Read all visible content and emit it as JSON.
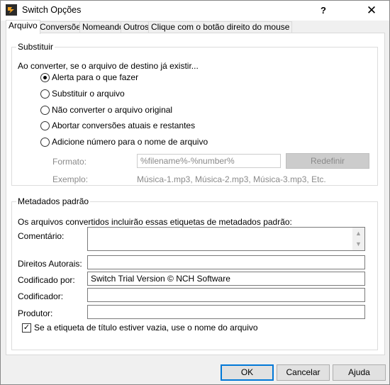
{
  "window": {
    "title": "Switch Opções",
    "help_label": "?",
    "close_label": "✕"
  },
  "tabs": [
    {
      "label": "Arquivo",
      "active": true
    },
    {
      "label": "Conversões"
    },
    {
      "label": "Nomeando"
    },
    {
      "label": "Outros"
    },
    {
      "label": "Clique com o botão direito do mouse"
    }
  ],
  "substituir": {
    "legend": "Substituir",
    "prompt": "Ao converter, se o arquivo de destino já existir...",
    "options": [
      {
        "label": "Alerta para o que fazer",
        "checked": true
      },
      {
        "label": "Substituir o arquivo"
      },
      {
        "label": "Não converter o arquivo original"
      },
      {
        "label": "Abortar conversões atuais e restantes"
      },
      {
        "label": "Adicione número para o nome de arquivo"
      }
    ],
    "format_label": "Formato:",
    "format_value": "%filename%-%number%",
    "reset_label": "Redefinir",
    "example_label": "Exemplo:",
    "example_value": "Música-1.mp3, Música-2.mp3, Música-3.mp3, Etc."
  },
  "metadados": {
    "legend": "Metadados padrão",
    "intro": "Os arquivos convertidos incluirão essas etiquetas de metadados padrão:",
    "comment_label": "Comentário:",
    "comment_value": "",
    "copyright_label": "Direitos Autorais:",
    "copyright_value": "",
    "encoded_by_label": "Codificado por:",
    "encoded_by_value": "Switch Trial Version © NCH Software",
    "encoder_label": "Codificador:",
    "encoder_value": "",
    "producer_label": "Produtor:",
    "producer_value": "",
    "title_checkbox_label": "Se a etiqueta de título estiver vazia, use o nome do arquivo",
    "title_checkbox_checked": true
  },
  "footer": {
    "ok_label": "OK",
    "cancel_label": "Cancelar",
    "help_label": "Ajuda"
  }
}
